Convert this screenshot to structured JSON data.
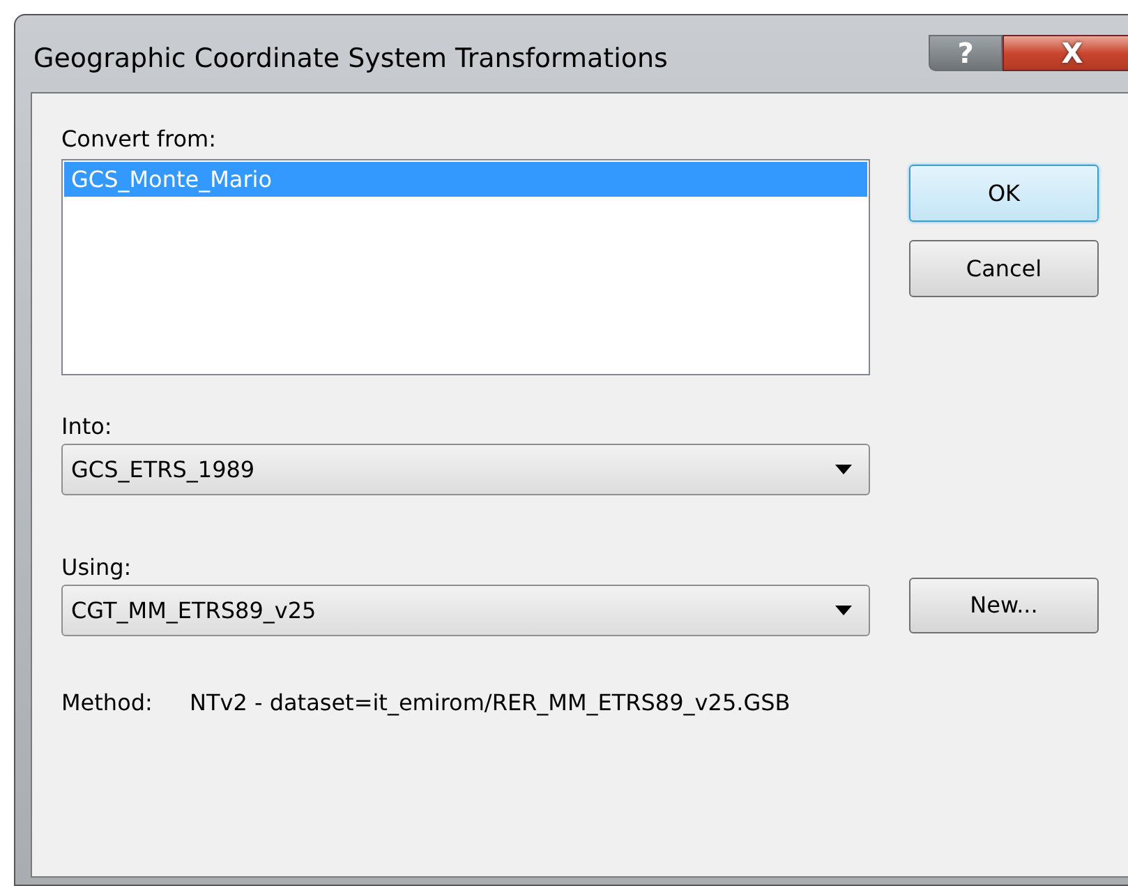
{
  "window": {
    "title": "Geographic Coordinate System Transformations",
    "help_button": "?",
    "close_button": "X"
  },
  "convert_from": {
    "label": "Convert from:",
    "items": [
      {
        "text": "GCS_Monte_Mario",
        "selected": true
      }
    ]
  },
  "into": {
    "label": "Into:",
    "value": "GCS_ETRS_1989"
  },
  "using": {
    "label": "Using:",
    "value": "CGT_MM_ETRS89_v25"
  },
  "buttons": [
    {
      "label": "OK",
      "default": true
    },
    {
      "label": "Cancel",
      "default": false
    }
  ],
  "new_button": "New...",
  "method": {
    "label": "Method:",
    "value": "NTv2 - dataset=it_emirom/RER_MM_ETRS89_v25.GSB"
  }
}
